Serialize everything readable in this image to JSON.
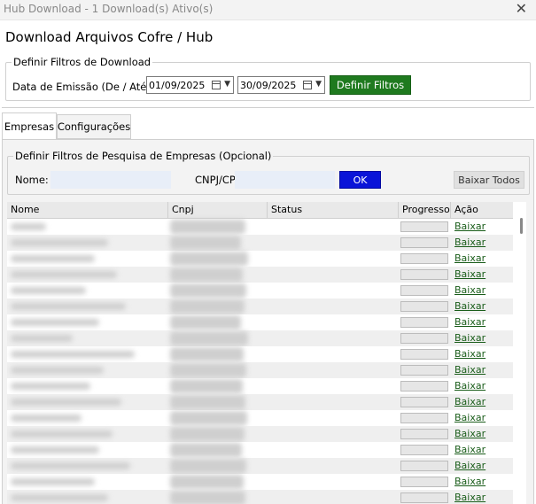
{
  "window": {
    "title": "Hub Download - 1 Download(s) Ativo(s)",
    "close_glyph": "✕"
  },
  "page": {
    "heading": "Download Arquivos Cofre / Hub"
  },
  "download_filters": {
    "legend": "Definir Filtros de Download",
    "date_label": "Data de Emissão (De / Até):",
    "date_from": "01/09/2025",
    "date_to": "30/09/2025",
    "apply_label": "Definir Filtros"
  },
  "tabs": [
    {
      "label": "Empresas",
      "active": true
    },
    {
      "label": "Configurações",
      "active": false
    }
  ],
  "company_filters": {
    "legend": "Definir Filtros de Pesquisa de Empresas (Opcional)",
    "name_label": "Nome:",
    "name_value": "",
    "cnpj_label": "CNPJ/CPF:",
    "cnpj_value": "",
    "ok_label": "OK",
    "download_all_label": "Baixar Todos"
  },
  "grid": {
    "columns": [
      "Nome",
      "Cnpj",
      "Status",
      "Progresso",
      "Ação"
    ],
    "rows": [
      {
        "status": "",
        "progress": 0,
        "action": "Baixar"
      },
      {
        "status": "",
        "progress": 0,
        "action": "Baixar"
      },
      {
        "status": "",
        "progress": 0,
        "action": "Baixar"
      },
      {
        "status": "",
        "progress": 0,
        "action": "Baixar"
      },
      {
        "status": "",
        "progress": 0,
        "action": "Baixar"
      },
      {
        "status": "",
        "progress": 0,
        "action": "Baixar"
      },
      {
        "status": "",
        "progress": 0,
        "action": "Baixar"
      },
      {
        "status": "",
        "progress": 0,
        "action": "Baixar"
      },
      {
        "status": "",
        "progress": 0,
        "action": "Baixar"
      },
      {
        "status": "",
        "progress": 0,
        "action": "Baixar"
      },
      {
        "status": "",
        "progress": 0,
        "action": "Baixar"
      },
      {
        "status": "",
        "progress": 0,
        "action": "Baixar"
      },
      {
        "status": "",
        "progress": 0,
        "action": "Baixar"
      },
      {
        "status": "",
        "progress": 0,
        "action": "Baixar"
      },
      {
        "status": "",
        "progress": 0,
        "action": "Baixar"
      },
      {
        "status": "",
        "progress": 0,
        "action": "Baixar"
      },
      {
        "status": "",
        "progress": 0,
        "action": "Baixar"
      },
      {
        "status": "",
        "progress": 0,
        "action": "Baixar"
      }
    ]
  },
  "colors": {
    "accent_green": "#1f7a1f",
    "ok_blue": "#0a14d8",
    "link_green": "#1a5d1a",
    "progress_fill": "#06b025"
  }
}
